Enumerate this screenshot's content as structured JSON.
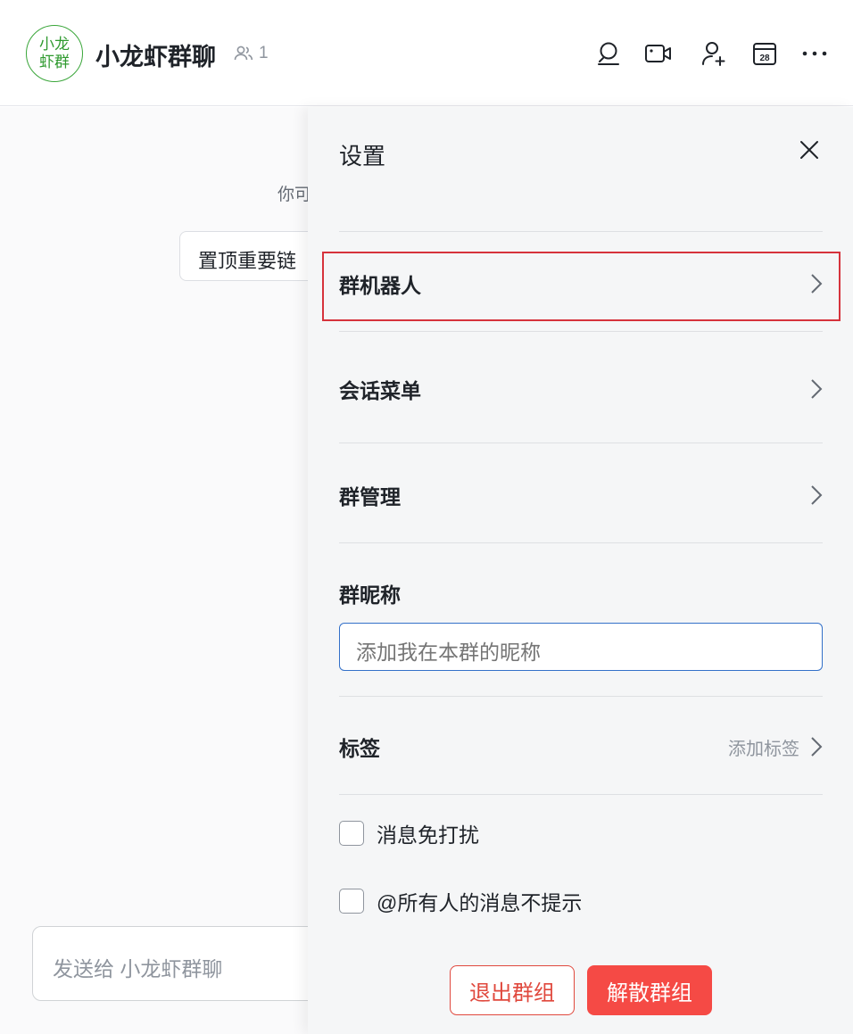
{
  "header": {
    "avatar_line1": "小龙",
    "avatar_line2": "虾群",
    "group_name": "小龙虾群聊",
    "member_count": "1",
    "icons": [
      "search-icon",
      "video-call-icon",
      "add-member-icon",
      "calendar-icon",
      "more-icon"
    ],
    "calendar_day": "28"
  },
  "chat": {
    "hint_text": "你可",
    "pin_button_label": "置顶重要链",
    "composer_placeholder": "发送给 小龙虾群聊"
  },
  "settings": {
    "title": "设置",
    "rows": {
      "group_bots": "群机器人",
      "session_menu": "会话菜单",
      "group_management": "群管理",
      "group_nickname": "群昵称",
      "tags": "标签",
      "tags_extra": "添加标签"
    },
    "nickname_placeholder": "添加我在本群的昵称",
    "mute_label": "消息免打扰",
    "mention_all_label": "@所有人的消息不提示",
    "quit_label": "退出群组",
    "dissolve_label": "解散群组"
  },
  "colors": {
    "accent_blue": "#3370c9",
    "danger_red": "#f54a45",
    "highlight_red": "#d6333c",
    "avatar_green": "#3aa63a"
  }
}
